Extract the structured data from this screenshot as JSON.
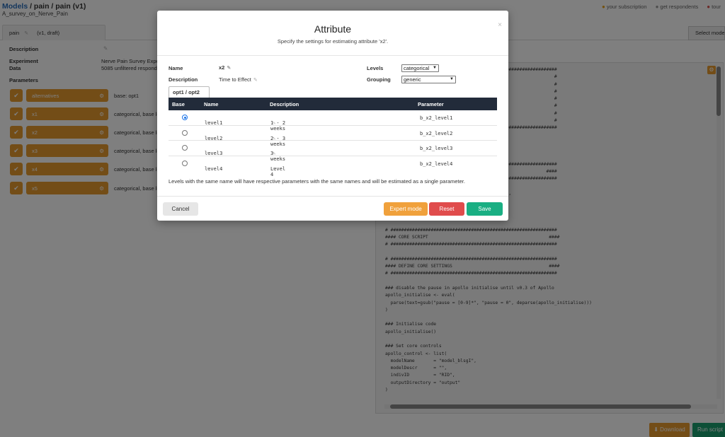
{
  "header": {
    "crumb_models": "Models",
    "crumb_rest": " / pain / pain (v1)",
    "subtitle": "A_survey_on_Nerve_Pain",
    "nav": [
      "your subscription",
      "get respondents",
      "tour"
    ]
  },
  "tabs": {
    "active_label": "pain",
    "active_version": "(v1, draft)",
    "select_model": "Select model"
  },
  "left": {
    "description_label": "Description",
    "experiment_label": "Experiment",
    "experiment_value": "Nerve Pain Survey Expe",
    "data_label": "Data",
    "data_value": "5085 unfiltered respond",
    "parameters_label": "Parameters",
    "params": [
      {
        "name": "alternatives",
        "desc": "base: opt1"
      },
      {
        "name": "x1",
        "desc": "categorical, base le"
      },
      {
        "name": "x2",
        "desc": "categorical, base le"
      },
      {
        "name": "x3",
        "desc": "categorical, base le"
      },
      {
        "name": "x4",
        "desc": "categorical, base le"
      },
      {
        "name": "x5",
        "desc": "categorical, base le"
      }
    ]
  },
  "code_lines": [
    "# ##############################################################",
    "#                                                              #",
    "#                                                              #",
    "#                            TC                                #",
    "#                            - pain                            #",
    "#                                                              #",
    "#                            .com                              #",
    "#                                                              #",
    "# ##############################################################",
    "",
    "                           ecution",
    "",
    "",
    "# ##############################################################",
    "                                                            ####",
    "# ##############################################################",
    "",
    "                          install, for example,",
    "                          talled.",
    "",
    "library('apollo')",
    "",
    "# ##############################################################",
    "#### CORE SCRIPT                                             ####",
    "# ##############################################################",
    "",
    "# ##############################################################",
    "#### DEFINE CORE SETTINGS                                    ####",
    "# ##############################################################",
    "",
    "### disable the pause in apollo initialise until v0.3 of Apollo",
    "apollo_initialise <- eval(",
    "  parse(text=gsub(\"pause = [0-9]*\", \"pause = 0\", deparse(apollo_initialise)))",
    ")",
    "",
    "### Initialise code",
    "apollo_initialise()",
    "",
    "### Set core controls",
    "apollo_control <- list(",
    "  modelName       = \"model_blsgI\",",
    "  modelDescr      = \"\",",
    "  indivID         = \"RID\",",
    "  outputDirectory = \"output\"",
    ")"
  ],
  "footer": {
    "download": "Download",
    "run": "Run script"
  },
  "modal": {
    "title": "Attribute",
    "subtitle": "Specify the settings for estimating attribute 'x2'.",
    "close": "×",
    "name_label": "Name",
    "name_value": "x2",
    "description_label": "Description",
    "description_value": "Time to Effect",
    "levels_label": "Levels",
    "levels_value": "categorical",
    "grouping_label": "Grouping",
    "grouping_value": "generic",
    "subtab": "opt1 / opt2",
    "columns": [
      "Base",
      "Name",
      "Description",
      "Parameter"
    ],
    "rows": [
      {
        "name": "level1",
        "desc": "1 - 2 weeks",
        "param": "b_x2_level1",
        "base": true
      },
      {
        "name": "level2",
        "desc": "2 - 3 weeks",
        "param": "b_x2_level2",
        "base": false
      },
      {
        "name": "level3",
        "desc": "3 weeks",
        "param": "b_x2_level3",
        "base": false
      },
      {
        "name": "level4",
        "desc": "Level 4",
        "param": "b_x2_level4",
        "base": false
      }
    ],
    "note": "Levels with the same name will have respective parameters with the same names and will be estimated as a single parameter.",
    "buttons": {
      "cancel": "Cancel",
      "expert": "Expert mode",
      "reset": "Reset",
      "save": "Save"
    }
  },
  "colors": {
    "accent_orange": "#e69a2e",
    "header_dark": "#222b3a",
    "save_green": "#1aaf83",
    "reset_red": "#e04c4c",
    "link_blue": "#2a6ebb"
  }
}
